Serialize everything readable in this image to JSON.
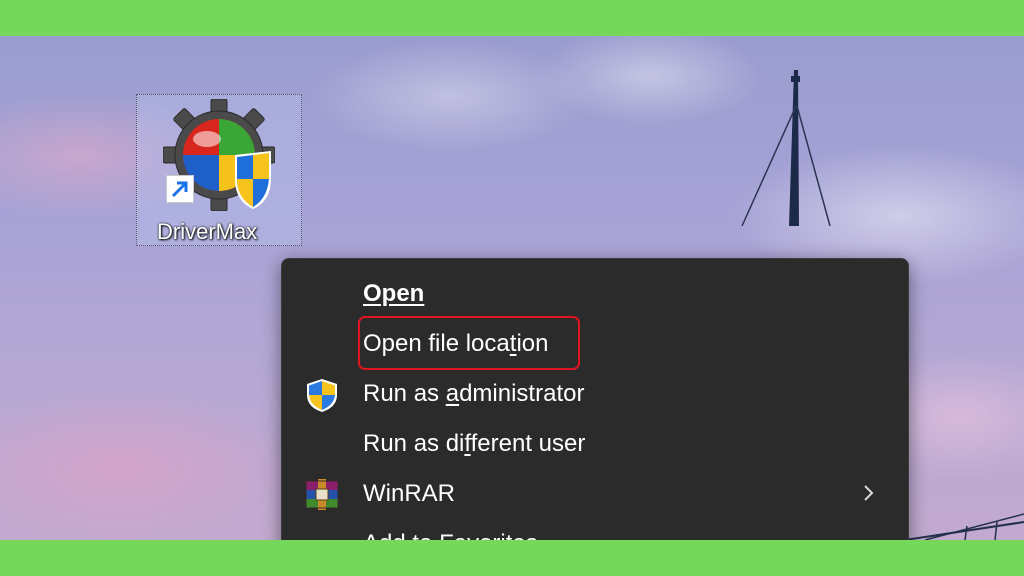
{
  "desktop": {
    "shortcut": {
      "label": "DriverMax",
      "icon": "drivermax-icon",
      "overlay": "shortcut-arrow-icon"
    }
  },
  "context_menu": {
    "items": [
      {
        "id": "open",
        "label": "Open",
        "icon": null,
        "bold": true,
        "access_key": "O"
      },
      {
        "id": "open-file-location",
        "label_parts": [
          "Open file loca",
          "t",
          "ion"
        ],
        "icon": null,
        "highlighted": true
      },
      {
        "id": "run-as-admin",
        "label_parts": [
          "Run as ",
          "a",
          "dministrator"
        ],
        "icon": "uac-shield-icon"
      },
      {
        "id": "run-as-different-user",
        "label_parts": [
          "Run as di",
          "f",
          "ferent user"
        ],
        "icon": null
      },
      {
        "id": "winrar",
        "label": "WinRAR",
        "icon": "winrar-icon",
        "submenu": true
      },
      {
        "id": "add-to-favorites",
        "label_parts": [
          "Add to ",
          "F",
          "avorites"
        ],
        "icon": null
      }
    ]
  },
  "colors": {
    "menu_bg": "#2b2b2b",
    "menu_text": "#ffffff",
    "highlight_border": "#e0141e",
    "frame_green": "#76d85a"
  }
}
